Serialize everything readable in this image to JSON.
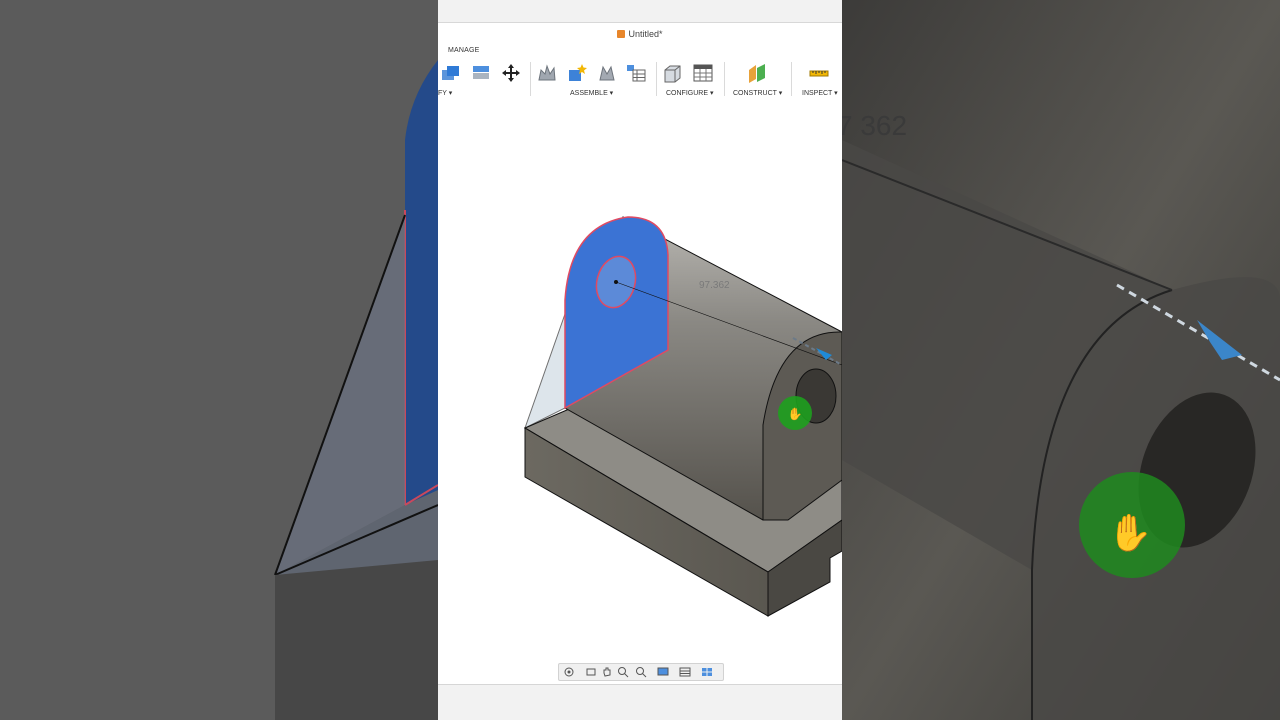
{
  "window": {
    "title": "Untitled*"
  },
  "ribbon": {
    "active_tab": "MANAGE",
    "groups": {
      "modify": "FY ▾",
      "assemble": "ASSEMBLE ▾",
      "configure": "CONFIGURE ▾",
      "construct": "CONSTRUCT ▾",
      "inspect": "INSPECT ▾"
    }
  },
  "canvas": {
    "dimension_value": "97.362",
    "zoomed_dimension_value": "7 362"
  },
  "colors": {
    "selection_blue": "#3b73d4",
    "body_gray": "#6b6760",
    "grab_green": "#1ea01e",
    "arrow_blue": "#1f8ad6"
  },
  "icons": [
    "move-icon",
    "joint-icon",
    "new-component-icon",
    "configure-icon",
    "plane-icon",
    "measure-icon",
    "orbit-icon",
    "pan-icon",
    "zoom-icon",
    "display-icon",
    "grid-icon",
    "viewports-icon"
  ]
}
